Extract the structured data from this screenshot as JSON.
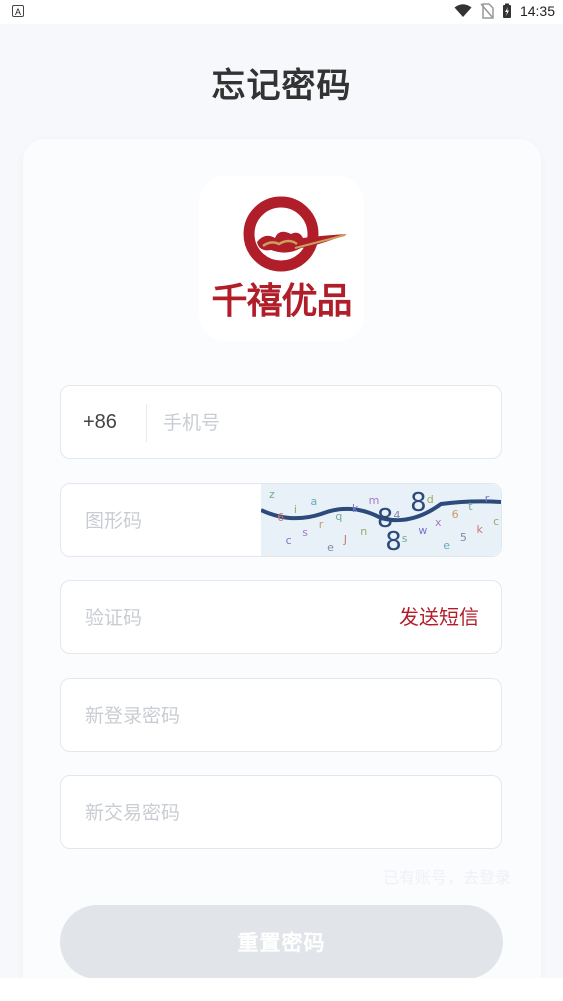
{
  "status_bar": {
    "notification_icon": "a-icon",
    "time": "14:35",
    "icons": [
      "wifi-icon",
      "no-sim-icon",
      "battery-charging-icon"
    ]
  },
  "page": {
    "title": "忘记密码"
  },
  "logo": {
    "text": "千禧优品",
    "brand_color": "#b01e2a",
    "accent_color": "#c9a25a"
  },
  "form": {
    "phone": {
      "country_code": "+86",
      "placeholder": "手机号",
      "value": ""
    },
    "captcha": {
      "placeholder": "图形码",
      "value": "",
      "image_chars": [
        "z",
        "6",
        "c",
        "i",
        "s",
        "a",
        "r",
        "e",
        "q",
        "J",
        "k",
        "n",
        "m",
        "8",
        "8",
        "4",
        "s",
        "8",
        "w",
        "d",
        "x",
        "e",
        "6",
        "5",
        "t",
        "k",
        "r",
        "c"
      ]
    },
    "sms_code": {
      "placeholder": "验证码",
      "value": "",
      "send_label": "发送短信"
    },
    "new_login_password": {
      "placeholder": "新登录密码",
      "value": ""
    },
    "new_trade_password": {
      "placeholder": "新交易密码",
      "value": ""
    }
  },
  "hint_text": "已有账号，去登录",
  "reset_button": {
    "label": "重置密码"
  },
  "colors": {
    "accent": "#b11e2a",
    "button_disabled": "#e1e5ea",
    "background": "#f6f8fb"
  }
}
